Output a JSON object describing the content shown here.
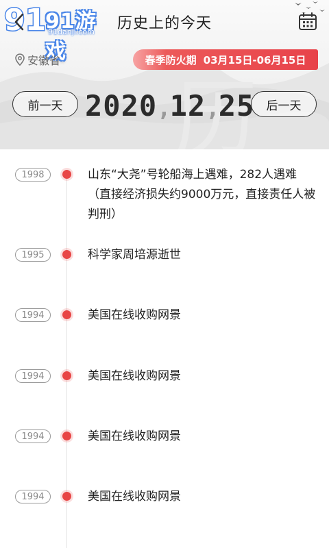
{
  "header": {
    "logo_brand": "91游戏",
    "logo_url": "91danji.com",
    "title": "历史上的今天",
    "location": "安徽省",
    "fire_label": "春季防火期",
    "fire_period": "03月15日-06月15日"
  },
  "date": {
    "prev_label": "前一天",
    "next_label": "后一天",
    "year": "2020",
    "month": "12",
    "day": "25",
    "separator": ","
  },
  "events": [
    {
      "year": "1998",
      "text": "山东“大尧”号轮船海上遇难，282人遇难（直接经济损失约9000万元，直接责任人被判刑）"
    },
    {
      "year": "1995",
      "text": "科学家周培源逝世"
    },
    {
      "year": "1994",
      "text": "美国在线收购网景"
    },
    {
      "year": "1994",
      "text": "美国在线收购网景"
    },
    {
      "year": "1994",
      "text": "美国在线收购网景"
    },
    {
      "year": "1994",
      "text": "美国在线收购网景"
    }
  ],
  "colors": {
    "accent_red": "#e84545",
    "logo_blue": "#4a86e8",
    "text_dark": "#222222",
    "text_muted": "#8a8a8a"
  },
  "icons": {
    "back": "chevron-left-icon",
    "calendar": "calendar-icon",
    "location": "location-pin-icon"
  }
}
